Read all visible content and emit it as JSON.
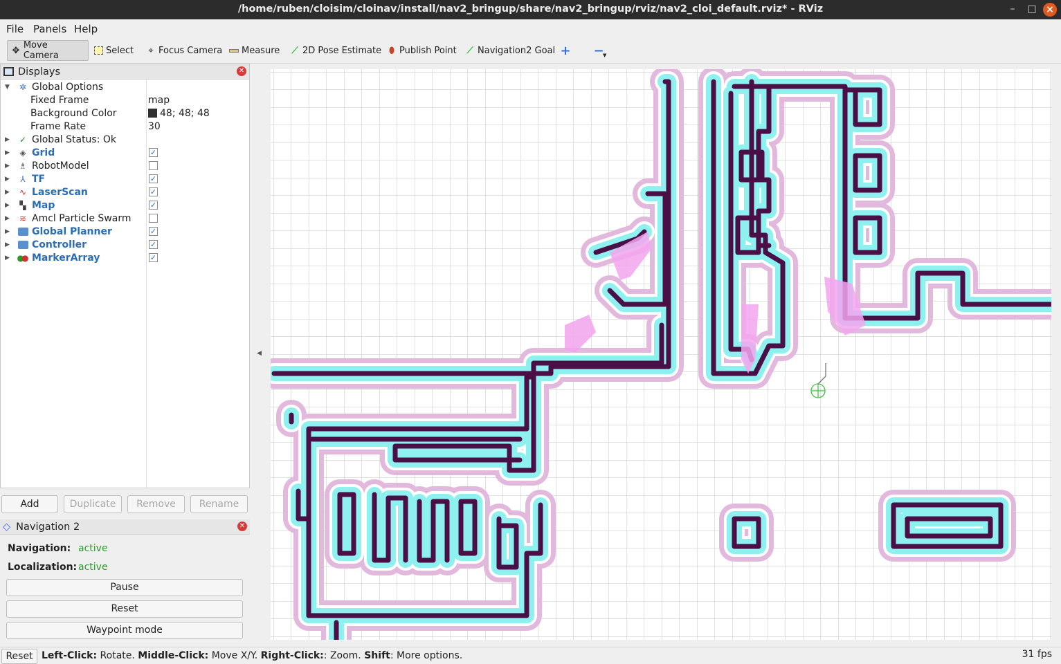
{
  "window": {
    "title": "/home/ruben/cloisim/cloinav/install/nav2_bringup/share/nav2_bringup/rviz/nav2_cloi_default.rviz* - RViz"
  },
  "menubar": {
    "items": [
      "File",
      "Panels",
      "Help"
    ]
  },
  "toolbar": {
    "tools": [
      {
        "label": "Move Camera",
        "icon": "move-camera-icon",
        "active": true
      },
      {
        "label": "Select",
        "icon": "select-icon"
      },
      {
        "label": "Focus Camera",
        "icon": "focus-camera-icon"
      },
      {
        "label": "Measure",
        "icon": "measure-icon"
      },
      {
        "label": "2D Pose Estimate",
        "icon": "pose-estimate-icon",
        "color": "#2fbd2f"
      },
      {
        "label": "Publish Point",
        "icon": "publish-point-icon",
        "color": "#c8452a"
      },
      {
        "label": "Navigation2 Goal",
        "icon": "nav-goal-icon",
        "color": "#2fbd2f"
      }
    ],
    "add_icon": "plus-icon",
    "remove_icon": "minus-icon"
  },
  "displays": {
    "title": "Displays",
    "global_options": {
      "label": "Global Options",
      "fixed_frame_label": "Fixed Frame",
      "fixed_frame": "map",
      "bg_color_label": "Background Color",
      "bg_color": "48; 48; 48",
      "frame_rate_label": "Frame Rate",
      "frame_rate": "30"
    },
    "global_status": "Global Status: Ok",
    "items": [
      {
        "label": "Grid",
        "checked": true,
        "icon": "grid-icon"
      },
      {
        "label": "RobotModel",
        "checked": false,
        "icon": "robot-model-icon"
      },
      {
        "label": "TF",
        "checked": true,
        "icon": "tf-icon"
      },
      {
        "label": "LaserScan",
        "checked": true,
        "icon": "laser-scan-icon"
      },
      {
        "label": "Map",
        "checked": true,
        "icon": "map-icon"
      },
      {
        "label": "Amcl Particle Swarm",
        "checked": false,
        "icon": "pose-array-icon"
      },
      {
        "label": "Global Planner",
        "checked": true,
        "icon": "folder-icon"
      },
      {
        "label": "Controller",
        "checked": true,
        "icon": "folder-icon"
      },
      {
        "label": "MarkerArray",
        "checked": true,
        "icon": "marker-array-icon"
      }
    ],
    "buttons": {
      "add": "Add",
      "duplicate": "Duplicate",
      "remove": "Remove",
      "rename": "Rename"
    }
  },
  "navigation2": {
    "title": "Navigation 2",
    "navigation_label": "Navigation:",
    "navigation_status": "active",
    "localization_label": "Localization:",
    "localization_status": "active",
    "pause": "Pause",
    "reset": "Reset",
    "waypoint_mode": "Waypoint mode"
  },
  "statusbar": {
    "reset": "Reset",
    "hint_parts": [
      "Left-Click:",
      " Rotate. ",
      "Middle-Click:",
      " Move X/Y. ",
      "Right-Click:",
      ": Zoom. ",
      "Shift",
      ": More options."
    ],
    "fps": "31 fps"
  },
  "colors": {
    "wall": "#4a0f47",
    "inflation_inner": "#8ef1f0",
    "inflation_outer": "#e3b8dd",
    "grid": "#bfbfbf",
    "robot": "#3ec53e"
  }
}
